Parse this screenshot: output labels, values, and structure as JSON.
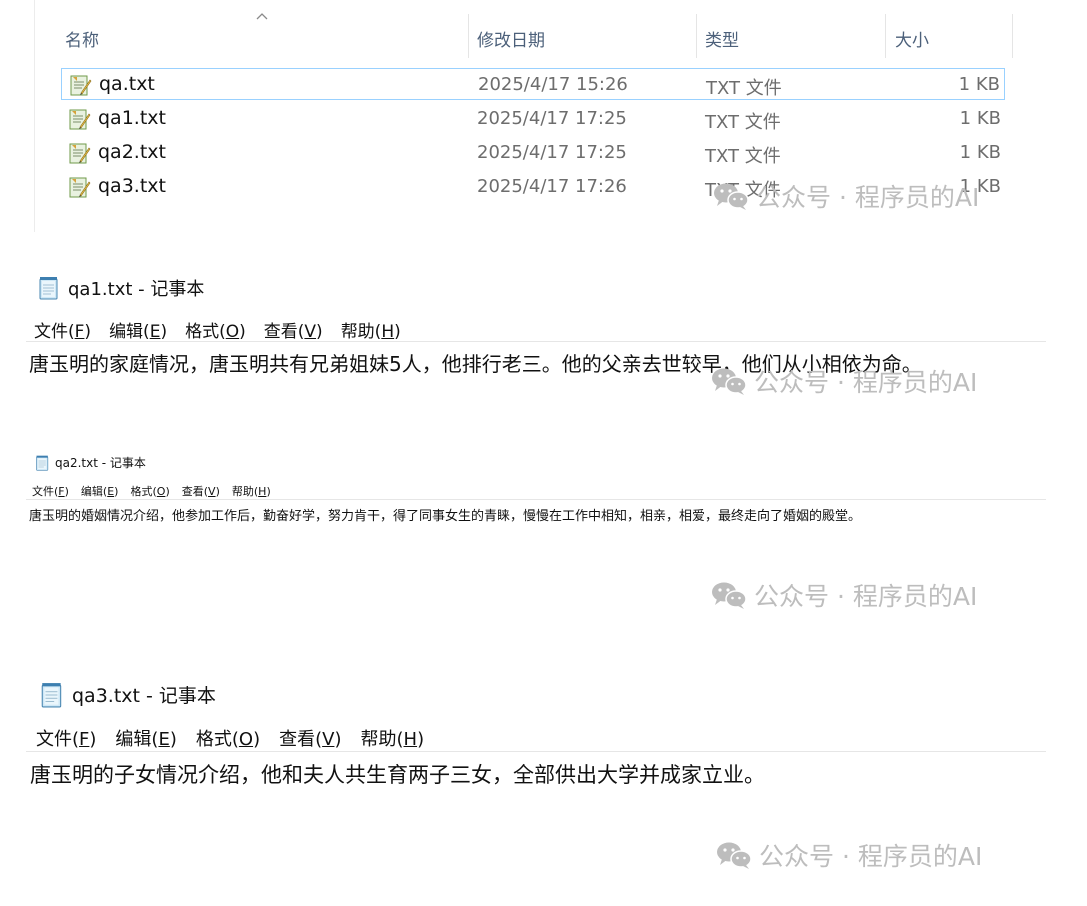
{
  "explorer": {
    "columns": {
      "name": "名称",
      "modified": "修改日期",
      "type": "类型",
      "size": "大小"
    },
    "files": [
      {
        "name": "qa.txt",
        "modified": "2025/4/17 15:26",
        "type": "TXT 文件",
        "size": "1 KB",
        "selected": true
      },
      {
        "name": "qa1.txt",
        "modified": "2025/4/17 17:25",
        "type": "TXT 文件",
        "size": "1 KB"
      },
      {
        "name": "qa2.txt",
        "modified": "2025/4/17 17:25",
        "type": "TXT 文件",
        "size": "1 KB"
      },
      {
        "name": "qa3.txt",
        "modified": "2025/4/17 17:26",
        "type": "TXT 文件",
        "size": "1 KB"
      }
    ]
  },
  "watermark": {
    "text": "公众号 · 程序员的AI",
    "icon": "wechat-icon"
  },
  "notepads": [
    {
      "title": "qa1.txt - 记事本",
      "menu": [
        {
          "label": "文件(",
          "key": "F",
          "close": ")"
        },
        {
          "label": "编辑(",
          "key": "E",
          "close": ")"
        },
        {
          "label": "格式(",
          "key": "O",
          "close": ")"
        },
        {
          "label": "查看(",
          "key": "V",
          "close": ")"
        },
        {
          "label": "帮助(",
          "key": "H",
          "close": ")"
        }
      ],
      "content": "唐玉明的家庭情况，唐玉明共有兄弟姐妹5人，他排行老三。他的父亲去世较早，他们从小相依为命。"
    },
    {
      "title": "qa2.txt - 记事本",
      "menu": [
        {
          "label": "文件(",
          "key": "F",
          "close": ")"
        },
        {
          "label": "编辑(",
          "key": "E",
          "close": ")"
        },
        {
          "label": "格式(",
          "key": "O",
          "close": ")"
        },
        {
          "label": "查看(",
          "key": "V",
          "close": ")"
        },
        {
          "label": "帮助(",
          "key": "H",
          "close": ")"
        }
      ],
      "content": "唐玉明的婚姻情况介绍，他参加工作后，勤奋好学，努力肯干，得了同事女生的青睐，慢慢在工作中相知，相亲，相爱，最终走向了婚姻的殿堂。"
    },
    {
      "title": "qa3.txt - 记事本",
      "menu": [
        {
          "label": "文件(",
          "key": "F",
          "close": ")"
        },
        {
          "label": "编辑(",
          "key": "E",
          "close": ")"
        },
        {
          "label": "格式(",
          "key": "O",
          "close": ")"
        },
        {
          "label": "查看(",
          "key": "V",
          "close": ")"
        },
        {
          "label": "帮助(",
          "key": "H",
          "close": ")"
        }
      ],
      "content": "唐玉明的子女情况介绍，他和夫人共生育两子三女，全部供出大学并成家立业。"
    }
  ],
  "colors": {
    "header_text": "#4c607a",
    "selection_border": "#99d1ff",
    "watermark": "#bdbdbd"
  }
}
